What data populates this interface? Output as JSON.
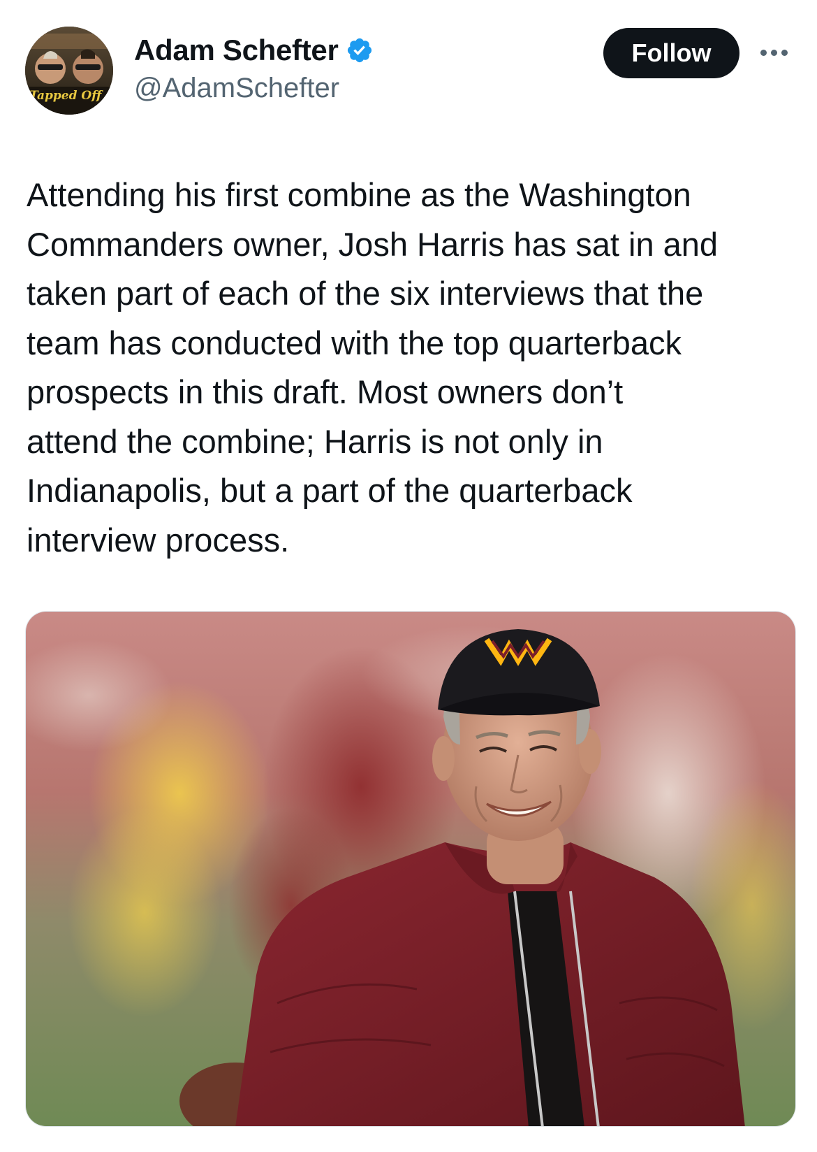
{
  "author": {
    "display_name": "Adam Schefter",
    "handle": "@AdamSchefter",
    "verified": true,
    "avatar_icon": "profile-photo",
    "avatar_banner_text": "Tapped Off"
  },
  "actions": {
    "follow_label": "Follow",
    "more_icon": "more-dots-icon"
  },
  "tweet": {
    "text": "Attending his first combine as the Washington\nCommanders owner, Josh Harris has sat in and\ntaken part of each of the six interviews that the\nteam has conducted with the top quarterback\nprospects in this draft. Most owners don’t\nattend the combine; Harris is not only in\nIndianapolis, but a part of the quarterback\ninterview process."
  },
  "media": {
    "kind": "photo",
    "logo_mark": "W"
  },
  "colors": {
    "text_primary": "#0f1419",
    "text_secondary": "#536471",
    "verified_blue": "#1d9bf0",
    "button_bg": "#0f1419",
    "burgundy": "#7a1f2b",
    "gold": "#ffb612"
  }
}
